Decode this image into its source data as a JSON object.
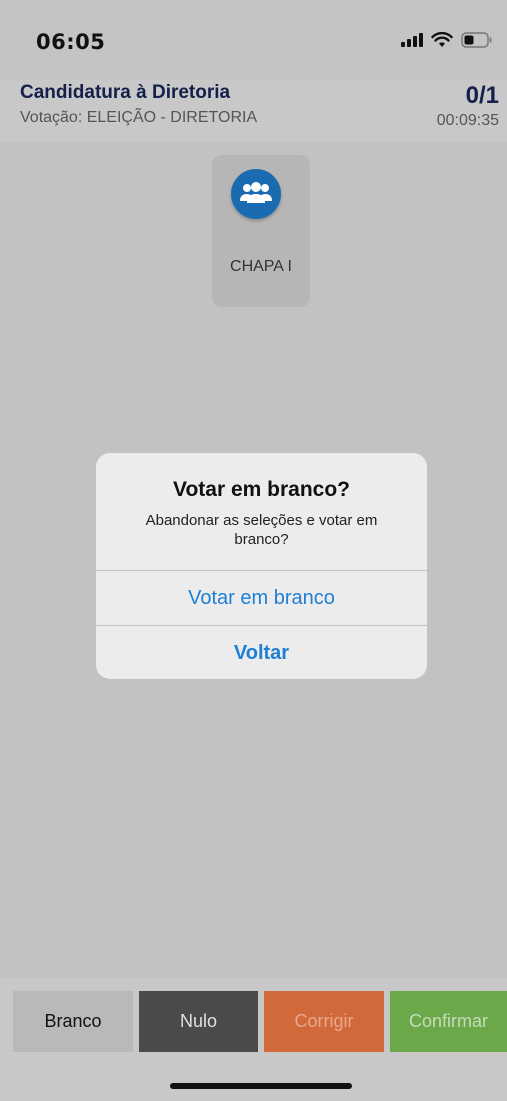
{
  "status_bar": {
    "time": "06:05",
    "icons": [
      "cellular-signal-icon",
      "wifi-icon",
      "battery-icon"
    ]
  },
  "header": {
    "title": "Candidatura à Diretoria",
    "subtitle": "Votação: ELEIÇÃO - DIRETORIA",
    "counter": "0/1",
    "timer": "00:09:35"
  },
  "candidates": [
    {
      "label": "CHAPA I",
      "icon": "group-icon",
      "icon_color": "#1b6bb0"
    }
  ],
  "dialog": {
    "title": "Votar em branco?",
    "message": "Abandonar as seleções e votar em branco?",
    "confirm_label": "Votar em branco",
    "cancel_label": "Voltar",
    "button_color": "#1d7fd6"
  },
  "actions": {
    "branco": {
      "label": "Branco",
      "bg": "#b9b9b9",
      "fg": "#111111"
    },
    "nulo": {
      "label": "Nulo",
      "bg": "#4a4a4a",
      "fg": "#e0e0e0"
    },
    "corrigir": {
      "label": "Corrigir",
      "bg": "#d2693a",
      "fg": "#e8a78a"
    },
    "confirmar": {
      "label": "Confirmar",
      "bg": "#6aa84a",
      "fg": "#c6dcb9"
    }
  }
}
